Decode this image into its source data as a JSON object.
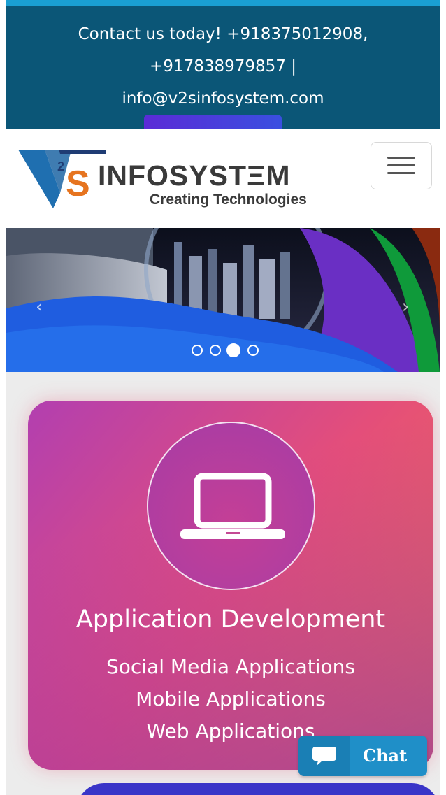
{
  "topbar": {
    "line1": "Contact us today! +918375012908,",
    "line2": "+917838979857 |",
    "line3": "info@v2sinfosystem.com"
  },
  "logo": {
    "mark_v": "V",
    "mark_2": "2",
    "mark_s": "S",
    "brand": "INFOSYSTΞM",
    "tagline": "Creating Technologies"
  },
  "banner": {
    "prev_icon": "‹",
    "next_icon": "›",
    "slide_count": 4,
    "active_slide": 3
  },
  "service_card": {
    "icon": "laptop-icon",
    "title": "Application Development",
    "items": [
      "Social Media Applications",
      "Mobile Applications",
      "Web Applications"
    ]
  },
  "chat_widget": {
    "icon": "chat-bubble-icon",
    "label": "Chat"
  },
  "colors": {
    "topbar": "#0b5677",
    "accent": "#1a9fd3",
    "card_start": "#b23fb0",
    "card_end": "#f5744a",
    "chat": "#1f8fc8"
  }
}
